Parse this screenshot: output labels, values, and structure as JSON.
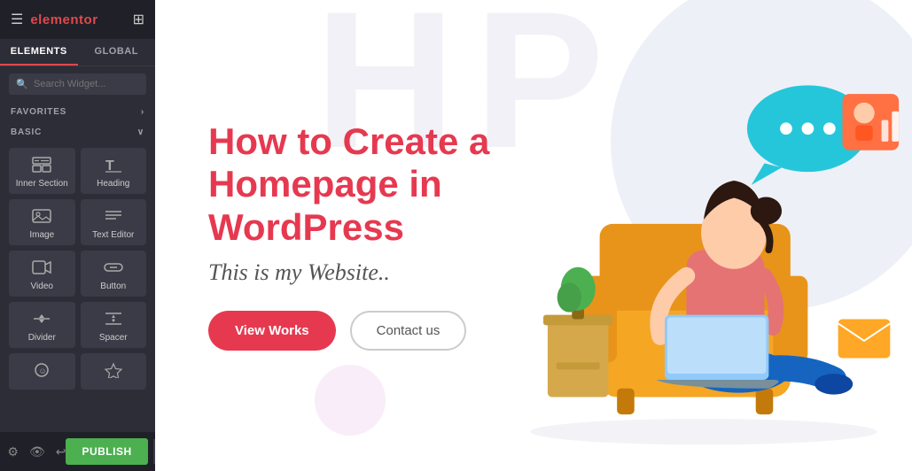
{
  "sidebar": {
    "logo": "elementor",
    "tabs": [
      {
        "id": "elements",
        "label": "ELEMENTS",
        "active": true
      },
      {
        "id": "global",
        "label": "GLOBAL",
        "active": false
      }
    ],
    "search": {
      "placeholder": "Search Widget..."
    },
    "favorites_label": "FAVORITES",
    "basic_label": "BASIC",
    "elements": [
      {
        "id": "inner-section",
        "label": "Inner Section",
        "icon": "inner-section-icon"
      },
      {
        "id": "heading",
        "label": "Heading",
        "icon": "heading-icon"
      },
      {
        "id": "image",
        "label": "Image",
        "icon": "image-icon"
      },
      {
        "id": "text-editor",
        "label": "Text Editor",
        "icon": "text-editor-icon"
      },
      {
        "id": "video",
        "label": "Video",
        "icon": "video-icon"
      },
      {
        "id": "button",
        "label": "Button",
        "icon": "button-icon"
      },
      {
        "id": "divider",
        "label": "Divider",
        "icon": "divider-icon"
      },
      {
        "id": "spacer",
        "label": "Spacer",
        "icon": "spacer-icon"
      },
      {
        "id": "icon-el",
        "label": "",
        "icon": "icon-el-icon"
      },
      {
        "id": "star",
        "label": "",
        "icon": "star-icon"
      }
    ],
    "publish_label": "PUBLISH"
  },
  "main": {
    "hero_title": "How to Create a Homepage in WordPress",
    "hero_subtitle": "This is my Website..",
    "btn_view_works": "View Works",
    "btn_contact": "Contact us"
  },
  "colors": {
    "accent_red": "#e63950",
    "sidebar_bg": "#2c2d36",
    "sidebar_dark": "#1f2028",
    "publish_green": "#4caf50"
  }
}
